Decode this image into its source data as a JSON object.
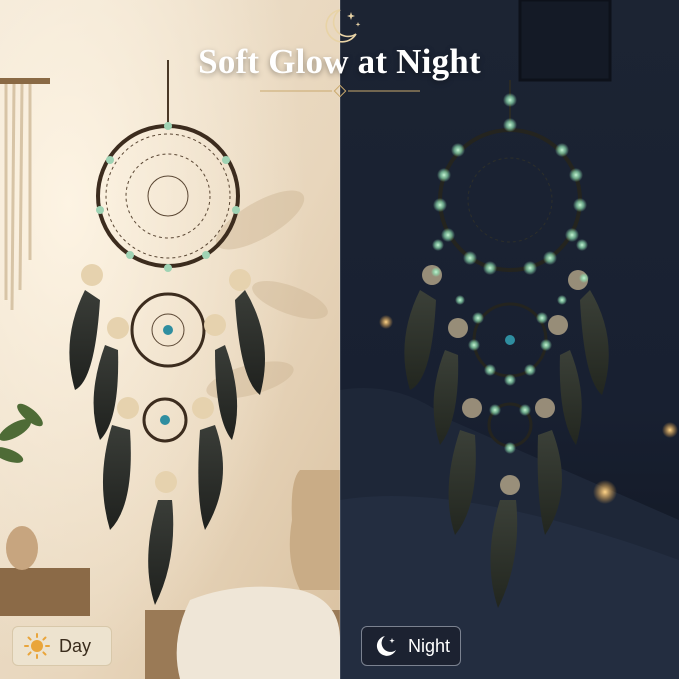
{
  "header": {
    "title": "Soft Glow at Night"
  },
  "labels": {
    "day": "Day",
    "night": "Night"
  },
  "colors": {
    "title_text": "#ffffff",
    "accent_gold": "#c9a96e",
    "glow_bead": "#a8e6c4",
    "day_badge_bg": "#ede3cf",
    "night_badge_bg": "#1c2230"
  },
  "icons": {
    "title": "crescent-moon-stars-icon",
    "day": "sun-icon",
    "night": "crescent-moon-icon"
  }
}
